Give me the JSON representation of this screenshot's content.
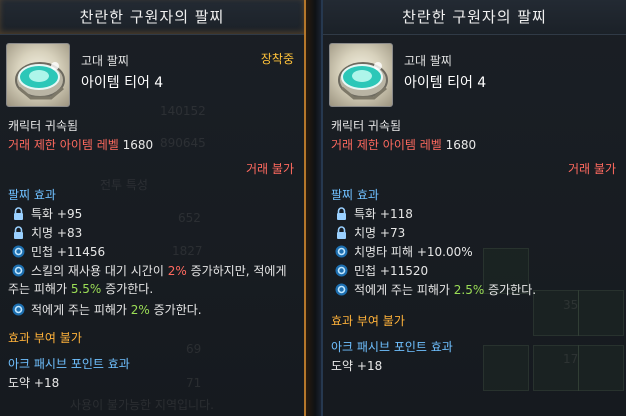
{
  "left": {
    "title": "찬란한 구원자의 팔찌",
    "grade": "고대 팔찌",
    "tier": "아이템 티어 4",
    "equipped": "장착중",
    "bound": "캐릭터 귀속됨",
    "level_req_label": "거래 제한 아이템 레벨",
    "level_req_value": "1680",
    "trade": "거래 불가",
    "effect_header": "팔찌 효과",
    "stats": [
      {
        "text": "특화 +95",
        "icon": "lock-icon"
      },
      {
        "text": "치명 +83",
        "icon": "lock-icon"
      },
      {
        "text": "민첩 +11456",
        "icon": "orb-icon"
      }
    ],
    "effect1": {
      "a": "스킬의 재사용 대기 시간이 ",
      "b": "2%",
      "c": " 증가하지만, 적에게",
      "d": "주는 피해가 ",
      "e": "5.5%",
      "f": " 증가한다."
    },
    "effect2": {
      "a": "적에게 주는 피해가 ",
      "b": "2%",
      "c": " 증가한다."
    },
    "grant": "효과 부여 불가",
    "ark_header": "아크 패시브 포인트 효과",
    "ark_value": "도약 +18",
    "bg_faded": [
      "140152",
      "890645",
      "전투 특성",
      "652",
      "1827",
      "69",
      "71",
      "사용이 불가능한 지역입니다."
    ]
  },
  "right": {
    "title": "찬란한 구원자의 팔찌",
    "grade": "고대 팔찌",
    "tier": "아이템 티어 4",
    "bound": "캐릭터 귀속됨",
    "level_req_label": "거래 제한 아이템 레벨",
    "level_req_value": "1680",
    "trade": "거래 불가",
    "effect_header": "팔찌 효과",
    "stats": [
      {
        "text": "특화 +118",
        "icon": "lock-icon"
      },
      {
        "text": "치명 +73",
        "icon": "lock-icon"
      },
      {
        "text": "치명타 피해 +10.00%",
        "icon": "orb-icon"
      },
      {
        "text": "민첩 +11520",
        "icon": "orb-icon"
      }
    ],
    "effect1": {
      "a": "적에게 주는 피해가 ",
      "b": "2.5%",
      "c": " 증가한다."
    },
    "grant": "효과 부여 불가",
    "ark_header": "아크 패시브 포인트 효과",
    "ark_value": "도약 +18",
    "bg_faded": [
      "35",
      "17"
    ]
  },
  "colors": {
    "accent_red": "#ff6a5f",
    "accent_blue": "#6fc0ff",
    "accent_green": "#9bde56",
    "equipped": "#ffc23a"
  }
}
